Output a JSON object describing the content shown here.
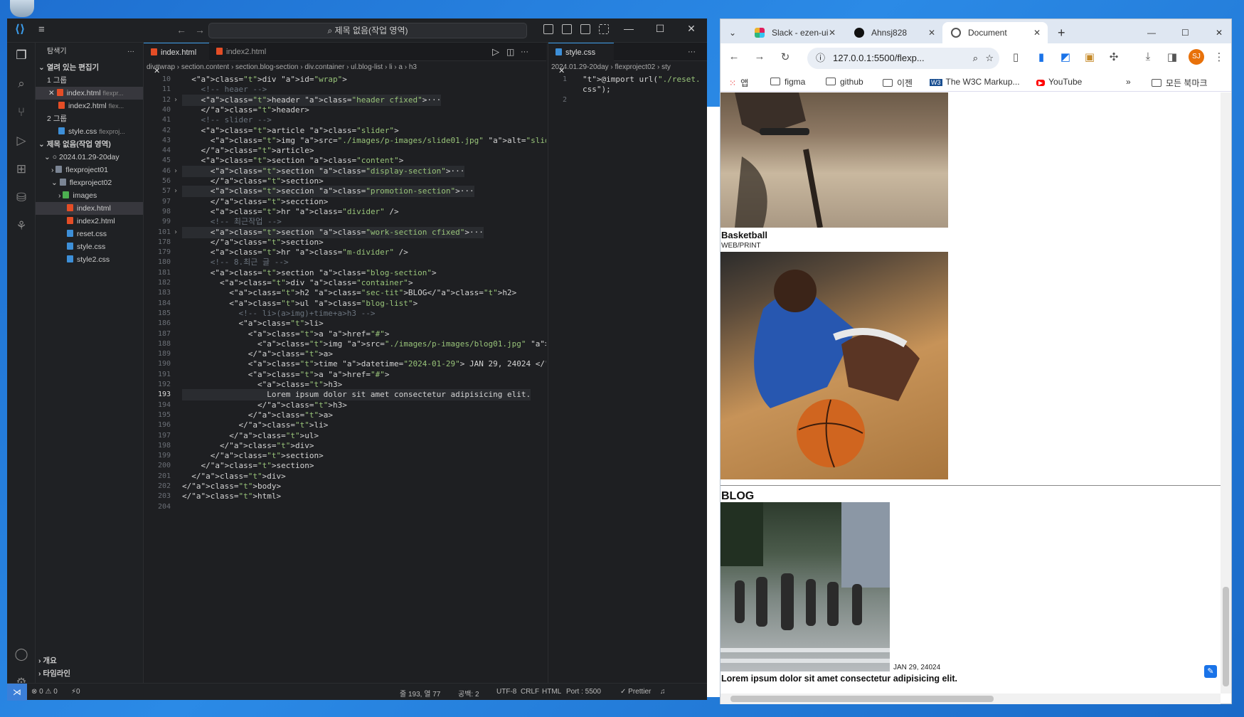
{
  "vscode": {
    "search": "제목 없음(작업 영역)",
    "sidebar": {
      "header": "탐색기",
      "open_editors": "열려 있는 편집기",
      "group1": "1 그룹",
      "file_index": "index.html",
      "file_index_hint": "flexpr...",
      "file_index2": "index2.html",
      "file_index2_hint": "flex...",
      "group2": "2 그룹",
      "file_style": "style.css",
      "file_style_hint": "flexproj...",
      "workspace": "제목 없음(작업 영역)",
      "root": "2024.01.29-20day",
      "f1": "flexproject01",
      "f2": "flexproject02",
      "images": "images",
      "t_index": "index.html",
      "t_index2": "index2.html",
      "t_reset": "reset.css",
      "t_style": "style.css",
      "t_style2": "style2.css",
      "outline": "개요",
      "timeline": "타임라인"
    },
    "tabs": {
      "t1": "index.html",
      "t2": "index2.html",
      "t3": "style.css"
    },
    "breadcrumb": "div#wrap  ›  section.content  ›  section.blog-section  ›  div.container  ›  ul.blog-list  ›  li  ›  a  ›  h3",
    "breadcrumb2": "2024.01.29-20day  ›  flexproject02  ›  sty",
    "lines": [
      {
        "n": "10",
        "code": "  <div id=\"wrap\">"
      },
      {
        "n": "11",
        "code": "    <!-- heaer -->"
      },
      {
        "n": "12",
        "code": "    <header class=\"header cfixed\">···"
      },
      {
        "n": "40",
        "code": "    </header>"
      },
      {
        "n": "41",
        "code": "    <!-- slider -->"
      },
      {
        "n": "42",
        "code": "    <article class=\"slider\">"
      },
      {
        "n": "43",
        "code": "      <img src=\"./images/p-images/slide01.jpg\" alt=\"slider\" />"
      },
      {
        "n": "44",
        "code": "    </article>"
      },
      {
        "n": "45",
        "code": "    <section class=\"content\">"
      },
      {
        "n": "46",
        "code": "      <section class=\"display-section\">···"
      },
      {
        "n": "56",
        "code": "      </section>"
      },
      {
        "n": "57",
        "code": "      <seccion class=\"promotion-section\">···"
      },
      {
        "n": "97",
        "code": "      </secction>"
      },
      {
        "n": "98",
        "code": "      <hr class=\"divider\" />"
      },
      {
        "n": "99",
        "code": "      <!-- 최근작업 -->"
      },
      {
        "n": "101",
        "code": "      <section class=\"work-section cfixed\">···"
      },
      {
        "n": "178",
        "code": "      </section>"
      },
      {
        "n": "179",
        "code": "      <hr class=\"m-divider\" />"
      },
      {
        "n": "180",
        "code": "      <!-- 8.최근 글 -->"
      },
      {
        "n": "181",
        "code": "      <section class=\"blog-section\">"
      },
      {
        "n": "182",
        "code": "        <div class=\"container\">"
      },
      {
        "n": "183",
        "code": "          <h2 class=\"sec-tit\">BLOG</h2>"
      },
      {
        "n": "184",
        "code": "          <ul class=\"blog-list\">"
      },
      {
        "n": "185",
        "code": "            <!-- li>(a>img)+time+a>h3 -->"
      },
      {
        "n": "186",
        "code": "            <li>"
      },
      {
        "n": "187",
        "code": "              <a href=\"#\">"
      },
      {
        "n": "188",
        "code": "                <img src=\"./images/p-images/blog01.jpg\" alt=\"blog01\" />"
      },
      {
        "n": "189",
        "code": "              </a>"
      },
      {
        "n": "190",
        "code": "              <time datetime=\"2024-01-29\"> JAN 29, 24024 </time>"
      },
      {
        "n": "191",
        "code": "              <a href=\"#\">"
      },
      {
        "n": "192",
        "code": "                <h3>"
      },
      {
        "n": "193",
        "code": "                  Lorem ipsum dolor sit amet consectetur adipisicing elit."
      },
      {
        "n": "194",
        "code": "                </h3>"
      },
      {
        "n": "195",
        "code": "              </a>"
      },
      {
        "n": "196",
        "code": "            </li>"
      },
      {
        "n": "197",
        "code": "          </ul>"
      },
      {
        "n": "198",
        "code": "        </div>"
      },
      {
        "n": "199",
        "code": "      </section>"
      },
      {
        "n": "200",
        "code": "    </section>"
      },
      {
        "n": "201",
        "code": "  </div>"
      },
      {
        "n": "202",
        "code": "</body>"
      },
      {
        "n": "203",
        "code": "</html>"
      },
      {
        "n": "204",
        "code": ""
      }
    ],
    "css_lines": [
      {
        "n": "1",
        "code": "@import url(\"./reset."
      },
      {
        "n": "",
        "code": "css\");"
      },
      {
        "n": "2",
        "code": ""
      }
    ],
    "status": {
      "errors": "⊗ 0 ⚠ 0",
      "ports": "⚡0",
      "position": "줄 193, 열 77",
      "spaces": "공백: 2",
      "encoding": "UTF-8",
      "eol": "CRLF",
      "lang": "HTML",
      "port": "Port : 5500",
      "prettier": "✓ Prettier"
    }
  },
  "chrome": {
    "tabs": [
      {
        "label": "Slack - ezen-ui"
      },
      {
        "label": "Ahnsj828"
      },
      {
        "label": "Document"
      }
    ],
    "url": "127.0.0.1:5500/flexp...",
    "avatar": "SJ",
    "bookmarks": [
      "앱",
      "figma",
      "github",
      "이젠",
      "The W3C Markup...",
      "YouTube"
    ],
    "bookmarks_all": "모든 북마크",
    "page": {
      "caption_title": "Basketball",
      "caption_sub": "WEB/PRINT",
      "blog_heading": "BLOG",
      "blog_time": "JAN 29, 24024",
      "blog_title": "Lorem ipsum dolor sit amet consectetur adipisicing elit."
    },
    "colors": {
      "tab_bar": "#dfe7f2",
      "omnibox": "#e9eef5"
    }
  }
}
